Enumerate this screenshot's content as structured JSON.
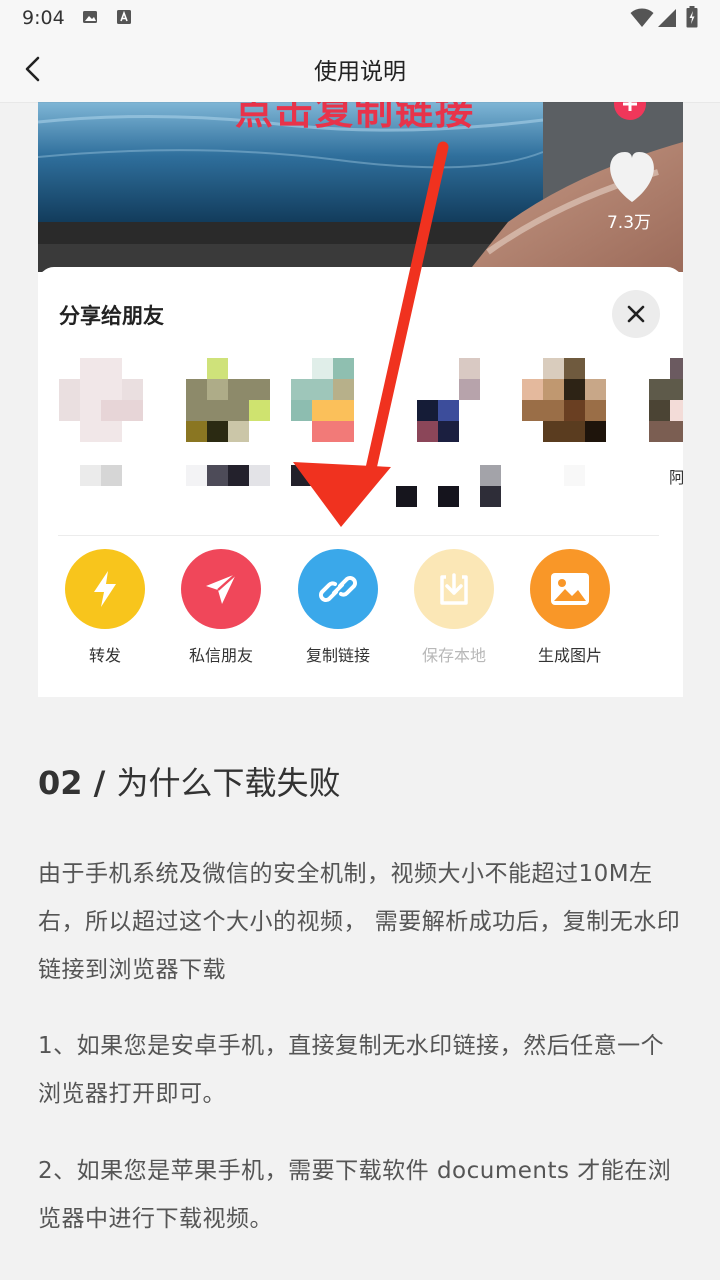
{
  "status_bar": {
    "time": "9:04"
  },
  "header": {
    "title": "使用说明"
  },
  "image": {
    "overlay_text": "点击复制链接",
    "likes": "7.3万",
    "share_title": "分享给朋友",
    "contact_partial_name": "阿",
    "actions": [
      {
        "label": "转发",
        "color": "#f8c51c"
      },
      {
        "label": "私信朋友",
        "color": "#f0475a"
      },
      {
        "label": "复制链接",
        "color": "#3aa8ea"
      },
      {
        "label": "保存本地",
        "color": "#fbe7b6"
      },
      {
        "label": "生成图片",
        "color": "#f99728"
      }
    ],
    "arrow_color": "#f0321f"
  },
  "section": {
    "number": "02",
    "separator": " / ",
    "title": "为什么下载失败",
    "paragraphs": [
      "由于手机系统及微信的安全机制，视频大小不能超过10M左右，所以超过这个大小的视频， 需要解析成功后，复制无水印链接到浏览器下载",
      "1、如果您是安卓手机，直接复制无水印链接，然后任意一个浏览器打开即可。",
      "2、如果您是苹果手机，需要下载软件 documents 才能在浏览器中进行下载视频。"
    ]
  }
}
